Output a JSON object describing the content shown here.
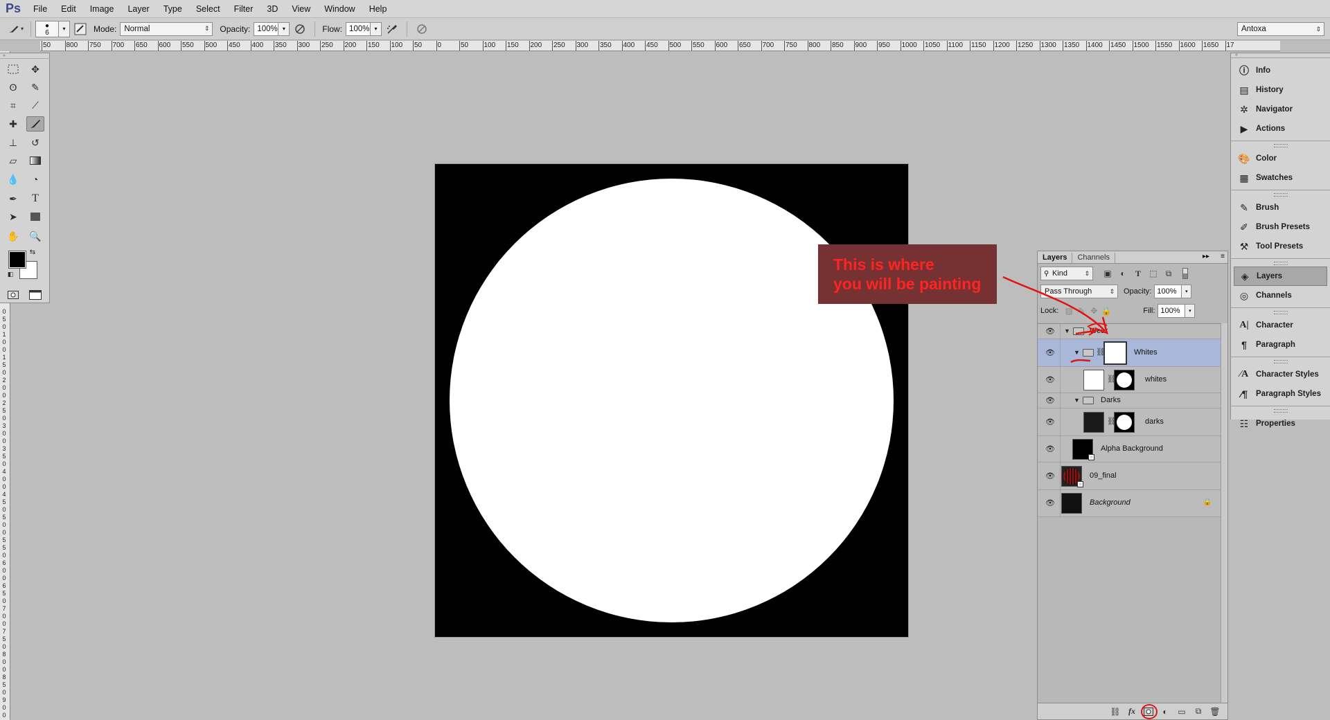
{
  "app": {
    "logo": "Ps"
  },
  "menubar": {
    "items": [
      "File",
      "Edit",
      "Image",
      "Layer",
      "Type",
      "Select",
      "Filter",
      "3D",
      "View",
      "Window",
      "Help"
    ]
  },
  "options": {
    "brush_size": "6",
    "mode_label": "Mode:",
    "mode_value": "Normal",
    "opacity_label": "Opacity:",
    "opacity_value": "100%",
    "flow_label": "Flow:",
    "flow_value": "100%",
    "workspace": "Antoxa"
  },
  "ruler": {
    "horizontal": [
      "50",
      "800",
      "750",
      "700",
      "650",
      "600",
      "550",
      "500",
      "450",
      "400",
      "350",
      "300",
      "250",
      "200",
      "150",
      "100",
      "50",
      "0",
      "50",
      "100",
      "150",
      "200",
      "250",
      "300",
      "350",
      "400",
      "450",
      "500",
      "550",
      "600",
      "650",
      "700",
      "750",
      "800",
      "850",
      "900",
      "950",
      "1000",
      "1050",
      "1100",
      "1150",
      "1200",
      "1250",
      "1300",
      "1350",
      "1400",
      "1450",
      "1500",
      "1550",
      "1600",
      "1650",
      "17"
    ],
    "vertical": [
      "0",
      "5",
      "0",
      "1",
      "0",
      "0",
      "1",
      "5",
      "0",
      "2",
      "0",
      "0",
      "2",
      "5",
      "0",
      "3",
      "0",
      "0",
      "3",
      "5",
      "0",
      "4",
      "0",
      "0",
      "4",
      "5",
      "0",
      "5",
      "0",
      "0",
      "5",
      "5",
      "0",
      "6",
      "0",
      "0",
      "6",
      "5",
      "0",
      "7",
      "0",
      "0",
      "7",
      "5",
      "0",
      "8",
      "0",
      "0",
      "8",
      "5",
      "0",
      "9",
      "0",
      "0"
    ]
  },
  "tools": [
    "marquee-tool",
    "move-tool",
    "lasso-tool",
    "quick-select-tool",
    "crop-tool",
    "eyedropper-tool",
    "healing-brush-tool",
    "brush-tool",
    "clone-stamp-tool",
    "history-brush-tool",
    "eraser-tool",
    "gradient-tool",
    "blur-tool",
    "dodge-tool",
    "pen-tool",
    "type-tool",
    "path-select-tool",
    "shape-tool",
    "hand-tool",
    "zoom-tool"
  ],
  "colors": {
    "foreground": "#000000",
    "background": "#ffffff",
    "annotation": "#ff2323",
    "selection": "#a9b7d8"
  },
  "annotation": {
    "line1": "This is where",
    "line2": "you will be painting"
  },
  "dock": {
    "groups": [
      [
        "Info",
        "History",
        "Navigator",
        "Actions"
      ],
      [
        "Color",
        "Swatches"
      ],
      [
        "Brush",
        "Brush Presets",
        "Tool Presets"
      ],
      [
        "Layers",
        "Channels"
      ],
      [
        "Character",
        "Paragraph"
      ],
      [
        "Character Styles",
        "Paragraph Styles"
      ],
      [
        "Properties"
      ]
    ],
    "active": "Layers"
  },
  "layers_panel": {
    "tabs": [
      "Layers",
      "Channels"
    ],
    "filter_kind": "Kind",
    "blend_mode": "Pass Through",
    "opacity_label": "Opacity:",
    "opacity_value": "100%",
    "lock_label": "Lock:",
    "fill_label": "Fill:",
    "fill_value": "100%",
    "layers": [
      {
        "name": "Wear",
        "type": "group",
        "indent": 0
      },
      {
        "name": "Whites",
        "type": "group-with-mask",
        "indent": 1,
        "selected": true
      },
      {
        "name": "whites",
        "type": "layer-with-mask",
        "indent": 2
      },
      {
        "name": "Darks",
        "type": "group",
        "indent": 1
      },
      {
        "name": "darks",
        "type": "layer-with-mask",
        "indent": 2
      },
      {
        "name": "Alpha Background",
        "type": "smart-object",
        "indent": 1
      },
      {
        "name": "09_final",
        "type": "smart-object",
        "indent": 0
      },
      {
        "name": "Background",
        "type": "background",
        "indent": 0,
        "locked": true
      }
    ]
  }
}
